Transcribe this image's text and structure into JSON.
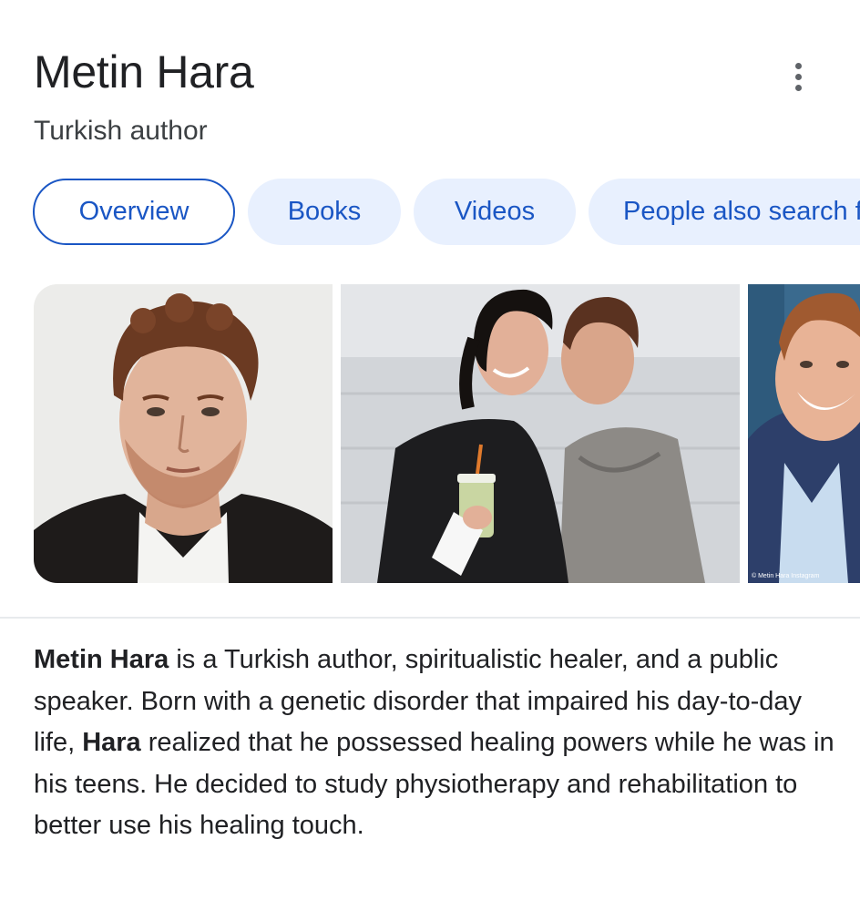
{
  "header": {
    "title": "Metin Hara",
    "subtitle": "Turkish author"
  },
  "tabs": [
    {
      "label": "Overview",
      "active": true
    },
    {
      "label": "Books",
      "active": false
    },
    {
      "label": "Videos",
      "active": false
    },
    {
      "label": "People also search for",
      "active": false
    }
  ],
  "images": {
    "photo3_caption": "© Metin Hara Instagram"
  },
  "description": {
    "part1_bold": "Metin Hara",
    "part2": " is a Turkish author, spiritualistic healer, and a public speaker. Born with a genetic disorder that impaired his day-to-day life, ",
    "part3_bold": "Hara",
    "part4": " realized that he possessed healing powers while he was in his teens. He decided to study physiotherapy and rehabilitation to better use his healing touch."
  },
  "colors": {
    "accent": "#1a56c4",
    "chip_bg": "#e8f0fe",
    "text": "#202124",
    "divider": "#e8eaed"
  },
  "icons": {
    "more": "more-vert-icon"
  }
}
